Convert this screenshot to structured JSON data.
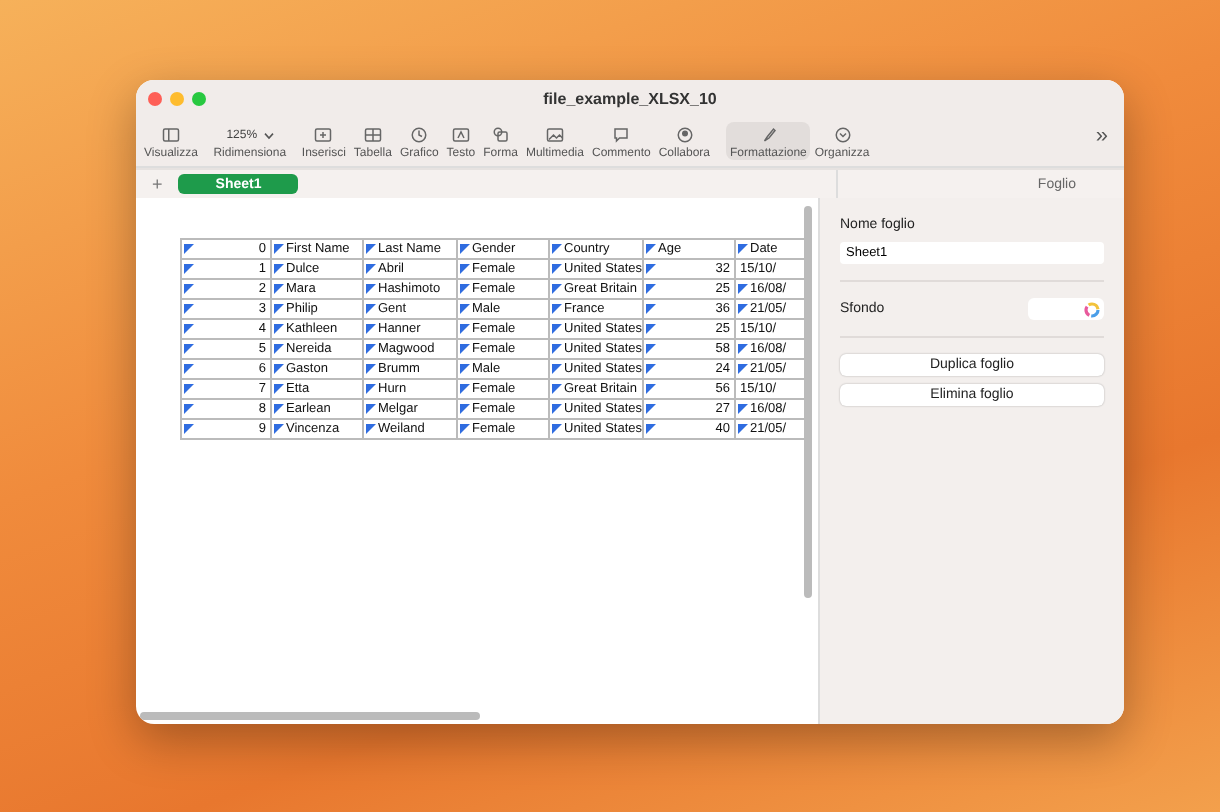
{
  "window": {
    "title": "file_example_XLSX_10"
  },
  "toolbar": {
    "zoom": "125%",
    "items": [
      {
        "label": "Visualizza",
        "selected": false
      },
      {
        "label": "Ridimensiona",
        "selected": false
      },
      {
        "label": "Inserisci",
        "selected": false
      },
      {
        "label": "Tabella",
        "selected": false
      },
      {
        "label": "Grafico",
        "selected": false
      },
      {
        "label": "Testo",
        "selected": false
      },
      {
        "label": "Forma",
        "selected": false
      },
      {
        "label": "Multimedia",
        "selected": false
      },
      {
        "label": "Commento",
        "selected": false
      },
      {
        "label": "Collabora",
        "selected": false
      },
      {
        "label": "Formattazione",
        "selected": true
      },
      {
        "label": "Organizza",
        "selected": false
      }
    ],
    "more": "»"
  },
  "sheet_tabs": {
    "add": "+",
    "tabs": [
      {
        "label": "Sheet1",
        "selected": true
      }
    ]
  },
  "table": {
    "rows": [
      {
        "cells": [
          {
            "text": "0",
            "flagged": true
          },
          {
            "text": "First Name",
            "flagged": true
          },
          {
            "text": "Last Name",
            "flagged": true
          },
          {
            "text": "Gender",
            "flagged": true
          },
          {
            "text": "Country",
            "flagged": true
          },
          {
            "text": "Age",
            "flagged": true
          },
          {
            "text": "Date",
            "flagged": true
          }
        ]
      },
      {
        "cells": [
          {
            "text": "1",
            "flagged": true
          },
          {
            "text": "Dulce",
            "flagged": true
          },
          {
            "text": "Abril",
            "flagged": true
          },
          {
            "text": "Female",
            "flagged": true
          },
          {
            "text": "United States",
            "flagged": true
          },
          {
            "text": "32",
            "flagged": true
          },
          {
            "text": "15/10/",
            "flagged": false
          }
        ]
      },
      {
        "cells": [
          {
            "text": "2",
            "flagged": true
          },
          {
            "text": "Mara",
            "flagged": true
          },
          {
            "text": "Hashimoto",
            "flagged": true
          },
          {
            "text": "Female",
            "flagged": true
          },
          {
            "text": "Great Britain",
            "flagged": true
          },
          {
            "text": "25",
            "flagged": true
          },
          {
            "text": "16/08/",
            "flagged": true
          }
        ]
      },
      {
        "cells": [
          {
            "text": "3",
            "flagged": true
          },
          {
            "text": "Philip",
            "flagged": true
          },
          {
            "text": "Gent",
            "flagged": true
          },
          {
            "text": "Male",
            "flagged": true
          },
          {
            "text": "France",
            "flagged": true
          },
          {
            "text": "36",
            "flagged": true
          },
          {
            "text": "21/05/",
            "flagged": true
          }
        ]
      },
      {
        "cells": [
          {
            "text": "4",
            "flagged": true
          },
          {
            "text": "Kathleen",
            "flagged": true
          },
          {
            "text": "Hanner",
            "flagged": true
          },
          {
            "text": "Female",
            "flagged": true
          },
          {
            "text": "United States",
            "flagged": true
          },
          {
            "text": "25",
            "flagged": true
          },
          {
            "text": "15/10/",
            "flagged": false
          }
        ]
      },
      {
        "cells": [
          {
            "text": "5",
            "flagged": true
          },
          {
            "text": "Nereida",
            "flagged": true
          },
          {
            "text": "Magwood",
            "flagged": true
          },
          {
            "text": "Female",
            "flagged": true
          },
          {
            "text": "United States",
            "flagged": true
          },
          {
            "text": "58",
            "flagged": true
          },
          {
            "text": "16/08/",
            "flagged": true
          }
        ]
      },
      {
        "cells": [
          {
            "text": "6",
            "flagged": true
          },
          {
            "text": "Gaston",
            "flagged": true
          },
          {
            "text": "Brumm",
            "flagged": true
          },
          {
            "text": "Male",
            "flagged": true
          },
          {
            "text": "United States",
            "flagged": true
          },
          {
            "text": "24",
            "flagged": true
          },
          {
            "text": "21/05/",
            "flagged": true
          }
        ]
      },
      {
        "cells": [
          {
            "text": "7",
            "flagged": true
          },
          {
            "text": "Etta",
            "flagged": true
          },
          {
            "text": "Hurn",
            "flagged": true
          },
          {
            "text": "Female",
            "flagged": true
          },
          {
            "text": "Great Britain",
            "flagged": true
          },
          {
            "text": "56",
            "flagged": true
          },
          {
            "text": "15/10/",
            "flagged": false
          }
        ]
      },
      {
        "cells": [
          {
            "text": "8",
            "flagged": true
          },
          {
            "text": "Earlean",
            "flagged": true
          },
          {
            "text": "Melgar",
            "flagged": true
          },
          {
            "text": "Female",
            "flagged": true
          },
          {
            "text": "United States",
            "flagged": true
          },
          {
            "text": "27",
            "flagged": true
          },
          {
            "text": "16/08/",
            "flagged": true
          }
        ]
      },
      {
        "cells": [
          {
            "text": "9",
            "flagged": true
          },
          {
            "text": "Vincenza",
            "flagged": true
          },
          {
            "text": "Weiland",
            "flagged": true
          },
          {
            "text": "Female",
            "flagged": true
          },
          {
            "text": "United States",
            "flagged": true
          },
          {
            "text": "40",
            "flagged": true
          },
          {
            "text": "21/05/",
            "flagged": true
          }
        ]
      }
    ]
  },
  "inspector": {
    "title": "Foglio",
    "name_label": "Nome foglio",
    "name_value": "Sheet1",
    "background_label": "Sfondo",
    "buttons": [
      "Duplica foglio",
      "Elimina foglio"
    ]
  }
}
